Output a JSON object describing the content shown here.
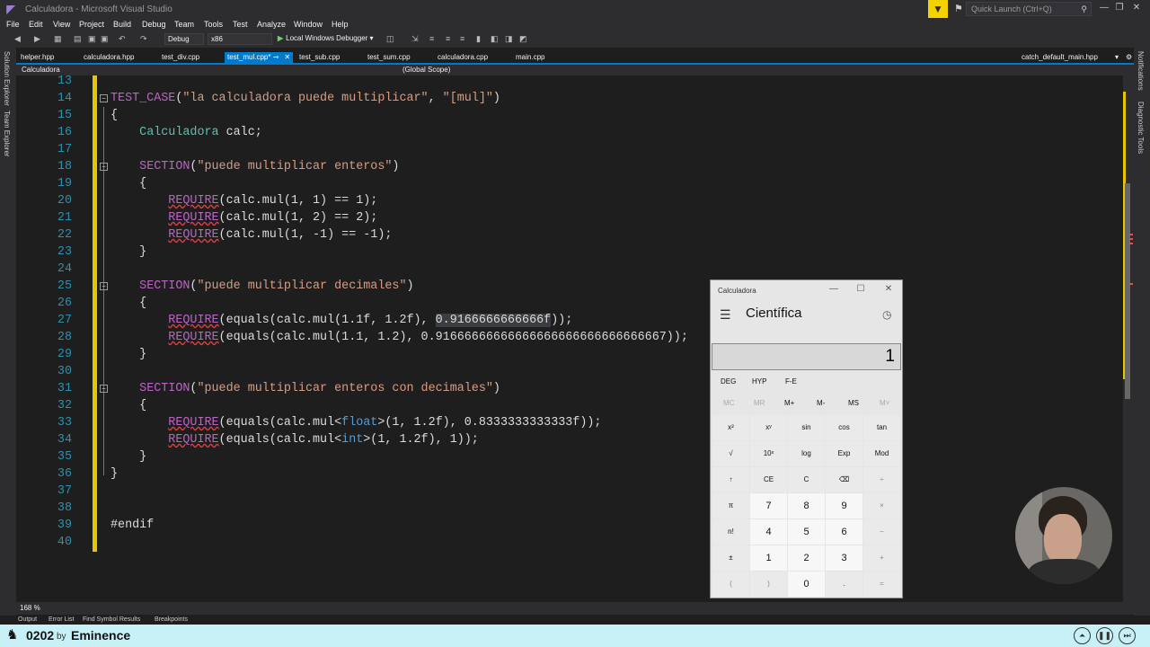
{
  "window": {
    "title": "Calculadora - Microsoft Visual Studio",
    "quick_launch_placeholder": "Quick Launch (Ctrl+Q)"
  },
  "menu": [
    "File",
    "Edit",
    "View",
    "Project",
    "Build",
    "Debug",
    "Team",
    "Tools",
    "Test",
    "Analyze",
    "Window",
    "Help"
  ],
  "toolbar": {
    "config": "Debug",
    "platform": "x86",
    "run_label": "Local Windows Debugger"
  },
  "tabs": [
    {
      "label": "helper.hpp",
      "active": false
    },
    {
      "label": "calculadora.hpp",
      "active": false
    },
    {
      "label": "test_div.cpp",
      "active": false
    },
    {
      "label": "test_mul.cpp*",
      "active": true
    },
    {
      "label": "test_sub.cpp",
      "active": false
    },
    {
      "label": "test_sum.cpp",
      "active": false
    },
    {
      "label": "calculadora.cpp",
      "active": false
    },
    {
      "label": "main.cpp",
      "active": false
    },
    {
      "label": "catch_default_main.hpp",
      "active": false
    }
  ],
  "navbar": {
    "project": "Calculadora",
    "scope": "(Global Scope)"
  },
  "side_panels": {
    "left": [
      "Solution Explorer",
      "Team Explorer"
    ],
    "right": [
      "Notifications",
      "Diagnostic Tools"
    ]
  },
  "code": {
    "line_numbers": [
      "13",
      "14",
      "15",
      "16",
      "17",
      "18",
      "19",
      "20",
      "21",
      "22",
      "23",
      "24",
      "25",
      "26",
      "27",
      "28",
      "29",
      "30",
      "31",
      "32",
      "33",
      "34",
      "35",
      "36",
      "37",
      "38",
      "39",
      "40"
    ],
    "test_case_name": "\"la calculadora puede multiplicar\"",
    "test_case_tag": "\"[mul]\"",
    "section1": "\"puede multiplicar enteros\"",
    "section2": "\"puede multiplicar decimales\"",
    "section3": "\"puede multiplicar enteros con decimales\"",
    "req20": "(calc.mul(1, 1) == 1);",
    "req21": "(calc.mul(1, 2) == 2);",
    "req22": "(calc.mul(1, -1) == -1);",
    "req27a": "(equals(calc.mul(1.1f, 1.2f), ",
    "req27b": "0.9166666666666f",
    "req27c": "));",
    "req28": "(equals(calc.mul(1.1, 1.2), 0.91666666666666666666666666666667));",
    "req33a": "(equals(calc.mul<",
    "req33b": "float",
    "req33c": ">(1, 1.2f), 0.8333333333333f));",
    "req34a": "(equals(calc.mul<",
    "req34b": "int",
    "req34c": ">(1, 1.2f), 1));",
    "endif": "#endif"
  },
  "status": {
    "zoom": "168 %"
  },
  "bottom_tabs": [
    "Output",
    "Error List",
    "Find Symbol Results",
    "Breakpoints"
  ],
  "calculator": {
    "title": "Calculadora",
    "mode": "Científica",
    "display": "1",
    "angle_buttons": [
      "DEG",
      "HYP",
      "F-E"
    ],
    "memory_buttons": [
      "MC",
      "MR",
      "M+",
      "M-",
      "MS",
      "M˅"
    ],
    "keys": [
      [
        "x²",
        "xʸ",
        "sin",
        "cos",
        "tan"
      ],
      [
        "√",
        "10ˣ",
        "log",
        "Exp",
        "Mod"
      ],
      [
        "↑",
        "CE",
        "C",
        "⌫",
        "÷"
      ],
      [
        "π",
        "7",
        "8",
        "9",
        "×"
      ],
      [
        "n!",
        "4",
        "5",
        "6",
        "−"
      ],
      [
        "±",
        "1",
        "2",
        "3",
        "+"
      ],
      [
        "(",
        ")",
        "0",
        ".",
        "="
      ]
    ]
  },
  "footer": {
    "episode": "0202",
    "by": "by",
    "author": "Eminence"
  },
  "colors": {
    "accent": "#007acc",
    "change_bar": "#e5c600",
    "macro": "#bd63c5",
    "string": "#d69d85",
    "type": "#4ec9b0",
    "keyword": "#569cd6",
    "line_number": "#2b91af",
    "footer_bg": "#c8f0f7"
  }
}
